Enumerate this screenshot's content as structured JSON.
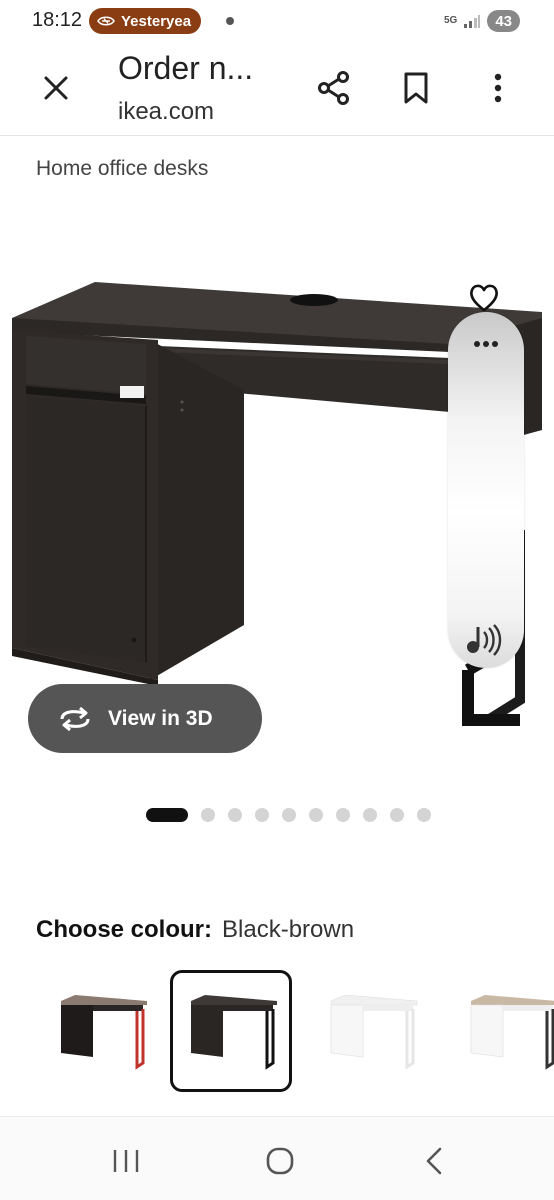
{
  "status_bar": {
    "time": "18:12",
    "notification_pill": "Yesteryea",
    "network": "5G",
    "battery": "43"
  },
  "header": {
    "title": "Order n...",
    "url": "ikea.com"
  },
  "breadcrumb": {
    "category": "Home office desks"
  },
  "product": {
    "view_3d_label": "View in 3D",
    "carousel": {
      "total": 10,
      "active": 0
    }
  },
  "colour": {
    "label": "Choose colour:",
    "value": "Black-brown",
    "options": [
      {
        "name": "swatch-black-brown-red"
      },
      {
        "name": "swatch-black-brown",
        "selected": true
      },
      {
        "name": "swatch-white"
      },
      {
        "name": "swatch-white-anthracite"
      }
    ]
  },
  "icons": {
    "close": "close-icon",
    "share": "share-icon",
    "bookmark": "bookmark-icon",
    "menu": "more-vertical-icon",
    "favourite": "heart-icon",
    "rotate": "rotate-3d-icon",
    "audio": "audio-icon"
  }
}
